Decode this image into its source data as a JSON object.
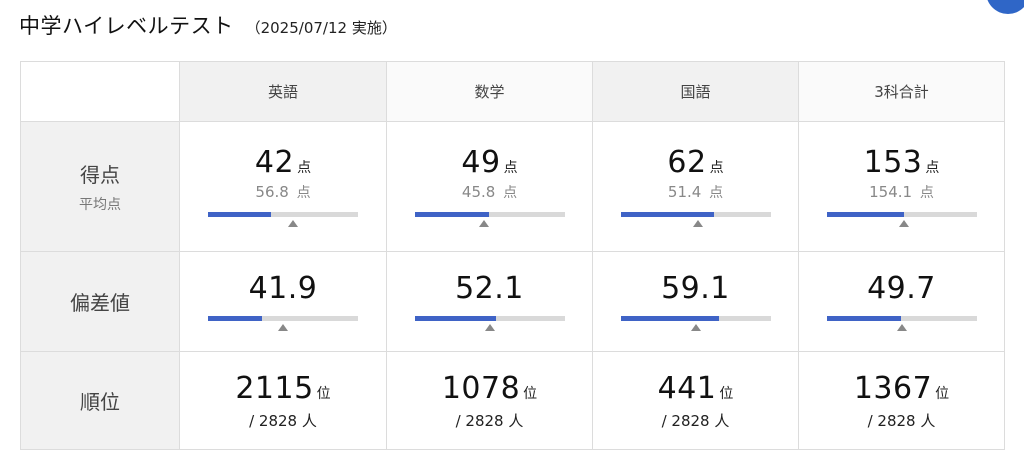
{
  "header": {
    "title": "中学ハイレベルテスト",
    "date": "（2025/07/12 実施）"
  },
  "columns": [
    "英語",
    "数学",
    "国語",
    "3科合計"
  ],
  "rows": {
    "score": {
      "label": "得点",
      "sublabel": "平均点"
    },
    "deviation": {
      "label": "偏差値"
    },
    "rank": {
      "label": "順位"
    }
  },
  "units": {
    "point": "点",
    "rank": "位",
    "people": "人"
  },
  "subjects": [
    {
      "score": "42",
      "average": "56.8",
      "score_fraction": 0.42,
      "average_fraction": 0.57,
      "deviation": "41.9",
      "deviation_fraction": 0.36,
      "deviation_marker_fraction": 0.5,
      "rank": "2115",
      "total": "/ 2828"
    },
    {
      "score": "49",
      "average": "45.8",
      "score_fraction": 0.49,
      "average_fraction": 0.46,
      "deviation": "52.1",
      "deviation_fraction": 0.54,
      "deviation_marker_fraction": 0.5,
      "rank": "1078",
      "total": "/ 2828"
    },
    {
      "score": "62",
      "average": "51.4",
      "score_fraction": 0.62,
      "average_fraction": 0.51,
      "deviation": "59.1",
      "deviation_fraction": 0.65,
      "deviation_marker_fraction": 0.5,
      "rank": "441",
      "total": "/ 2828"
    },
    {
      "score": "153",
      "average": "154.1",
      "score_fraction": 0.51,
      "average_fraction": 0.51,
      "deviation": "49.7",
      "deviation_fraction": 0.49,
      "deviation_marker_fraction": 0.5,
      "rank": "1367",
      "total": "/ 2828"
    }
  ],
  "colors": {
    "bar_fill": "#3f63c6",
    "bar_track": "#d9d9d9",
    "marker": "#888888",
    "accent_corner": "#2f66c7"
  }
}
